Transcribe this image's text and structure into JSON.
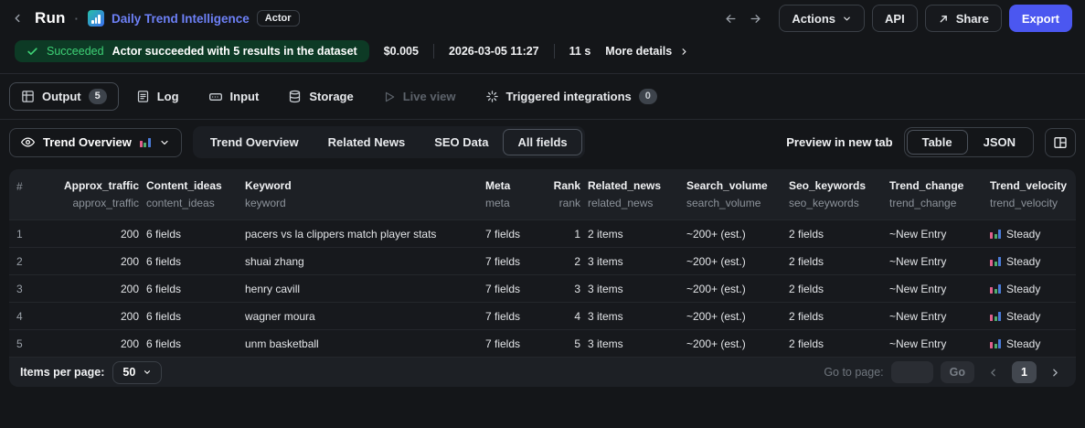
{
  "header": {
    "title": "Run",
    "actor_name": "Daily Trend Intelligence",
    "actor_badge": "Actor",
    "actions_label": "Actions",
    "api_label": "API",
    "share_label": "Share",
    "export_label": "Export"
  },
  "status": {
    "badge_label": "Succeeded",
    "message": "Actor succeeded with 5 results in the dataset",
    "cost": "$0.005",
    "datetime": "2026-03-05 11:27",
    "duration": "11 s",
    "more_details_label": "More details"
  },
  "run_tabs": {
    "output": {
      "label": "Output",
      "badge": "5"
    },
    "log": {
      "label": "Log"
    },
    "input": {
      "label": "Input"
    },
    "storage": {
      "label": "Storage"
    },
    "live_view": {
      "label": "Live view"
    },
    "integrations": {
      "label": "Triggered integrations",
      "badge": "0"
    }
  },
  "toolbar": {
    "view_selector_label": "Trend Overview",
    "view_tabs": {
      "trend_overview": "Trend Overview",
      "related_news": "Related News",
      "seo_data": "SEO Data",
      "all_fields": "All fields"
    },
    "preview_label": "Preview in new tab",
    "format_table": "Table",
    "format_json": "JSON"
  },
  "table": {
    "columns": {
      "index": {
        "title": "#"
      },
      "approx_traffic": {
        "title": "Approx_traffic",
        "sub": "approx_traffic"
      },
      "content_ideas": {
        "title": "Content_ideas",
        "sub": "content_ideas"
      },
      "keyword": {
        "title": "Keyword",
        "sub": "keyword"
      },
      "meta": {
        "title": "Meta",
        "sub": "meta"
      },
      "rank": {
        "title": "Rank",
        "sub": "rank"
      },
      "related_news": {
        "title": "Related_news",
        "sub": "related_news"
      },
      "search_volume": {
        "title": "Search_volume",
        "sub": "search_volume"
      },
      "seo_keywords": {
        "title": "Seo_keywords",
        "sub": "seo_keywords"
      },
      "trend_change": {
        "title": "Trend_change",
        "sub": "trend_change"
      },
      "trend_velocity": {
        "title": "Trend_velocity",
        "sub": "trend_velocity"
      }
    },
    "rows": [
      {
        "index": "1",
        "approx_traffic": "200",
        "content_ideas": "6 fields",
        "keyword": "pacers vs la clippers match player stats",
        "meta": "7 fields",
        "rank": "1",
        "related_news": "2 items",
        "search_volume": "~200+ (est.)",
        "seo_keywords": "2 fields",
        "trend_change": "~New Entry",
        "trend_velocity": "Steady"
      },
      {
        "index": "2",
        "approx_traffic": "200",
        "content_ideas": "6 fields",
        "keyword": "shuai zhang",
        "meta": "7 fields",
        "rank": "2",
        "related_news": "3 items",
        "search_volume": "~200+ (est.)",
        "seo_keywords": "2 fields",
        "trend_change": "~New Entry",
        "trend_velocity": "Steady"
      },
      {
        "index": "3",
        "approx_traffic": "200",
        "content_ideas": "6 fields",
        "keyword": "henry cavill",
        "meta": "7 fields",
        "rank": "3",
        "related_news": "3 items",
        "search_volume": "~200+ (est.)",
        "seo_keywords": "2 fields",
        "trend_change": "~New Entry",
        "trend_velocity": "Steady"
      },
      {
        "index": "4",
        "approx_traffic": "200",
        "content_ideas": "6 fields",
        "keyword": "wagner moura",
        "meta": "7 fields",
        "rank": "4",
        "related_news": "3 items",
        "search_volume": "~200+ (est.)",
        "seo_keywords": "2 fields",
        "trend_change": "~New Entry",
        "trend_velocity": "Steady"
      },
      {
        "index": "5",
        "approx_traffic": "200",
        "content_ideas": "6 fields",
        "keyword": "unm basketball",
        "meta": "7 fields",
        "rank": "5",
        "related_news": "3 items",
        "search_volume": "~200+ (est.)",
        "seo_keywords": "2 fields",
        "trend_change": "~New Entry",
        "trend_velocity": "Steady"
      }
    ]
  },
  "pagination": {
    "items_per_page_label": "Items per page:",
    "items_per_page_value": "50",
    "goto_label": "Go to page:",
    "go_label": "Go",
    "current_page": "1"
  },
  "colors": {
    "accent_blue": "#4b57f0",
    "link_blue": "#6d80f6",
    "success_green": "#3ed276",
    "success_bg": "#0d3a25"
  }
}
